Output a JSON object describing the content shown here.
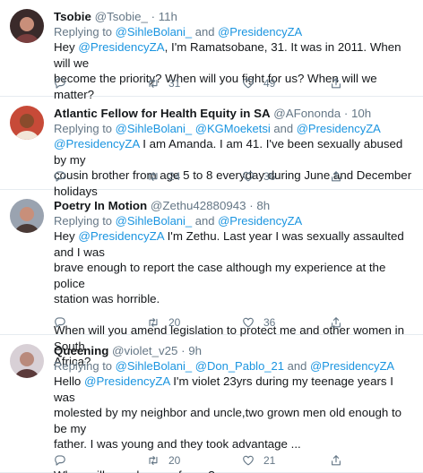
{
  "tweets": [
    {
      "name": "Tsobie",
      "handle": "@Tsobie_",
      "time": "11h",
      "reply_prefix": "Replying to",
      "reply_mentions": [
        "@SihleBolani_",
        "@PresidencyZA"
      ],
      "reply_join": [
        "and"
      ],
      "body_lines": [
        [
          {
            "t": "Hey "
          },
          {
            "m": "@PresidencyZA"
          },
          {
            "t": ", I'm Ramatsobane, 31. It was in 2011. When will we"
          }
        ],
        [
          {
            "t": "become the priority? When will you fight for us? When will we matter?"
          }
        ]
      ],
      "retweets": "31",
      "likes": "49"
    },
    {
      "name": "Atlantic Fellow for Health Equity in SA",
      "handle": "@AFononda",
      "time": "10h",
      "reply_prefix": "Replying to",
      "reply_mentions": [
        "@SihleBolani_",
        "@KGMoeketsi",
        "@PresidencyZA"
      ],
      "reply_join": [
        "",
        "and"
      ],
      "body_lines": [
        [
          {
            "m": "@PresidencyZA"
          },
          {
            "t": " I am Amanda. I am 41. I've been sexually abused by my"
          }
        ],
        [
          {
            "t": "cousin brother from age 5 to 8 everyday during June and December holidays"
          }
        ]
      ],
      "retweets": "24",
      "likes": "36"
    },
    {
      "name": "Poetry In Motion",
      "handle": "@Zethu42880943",
      "time": "8h",
      "reply_prefix": "Replying to",
      "reply_mentions": [
        "@SihleBolani_",
        "@PresidencyZA"
      ],
      "reply_join": [
        "and"
      ],
      "body_lines": [
        [
          {
            "t": "Hey "
          },
          {
            "m": "@PresidencyZA"
          },
          {
            "t": " I'm Zethu. Last year I was sexually assaulted and I was"
          }
        ],
        [
          {
            "t": "brave enough to report the case although my experience at the police"
          }
        ],
        [
          {
            "t": "station was horrible."
          }
        ],
        [],
        [
          {
            "t": "When will you amend legislation to protect me and other women in South"
          }
        ],
        [
          {
            "t": "Africa?"
          }
        ]
      ],
      "retweets": "20",
      "likes": "36"
    },
    {
      "name": "Queening",
      "handle": "@violet_v25",
      "time": "9h",
      "reply_prefix": "Replying to",
      "reply_mentions": [
        "@SihleBolani_",
        "@Don_Pablo_21",
        "@PresidencyZA"
      ],
      "reply_join": [
        "",
        "and"
      ],
      "body_lines": [
        [
          {
            "t": "Hello "
          },
          {
            "m": "@PresidencyZA"
          },
          {
            "t": " I'm violet 23yrs during my teenage years I was"
          }
        ],
        [
          {
            "t": "molested by my neighbor and uncle,two grown men old enough to be my"
          }
        ],
        [
          {
            "t": "father. I was young and they took advantage ..."
          }
        ],
        [],
        [
          {
            "t": "When will you show up for us?"
          }
        ]
      ],
      "retweets": "20",
      "likes": "21"
    }
  ],
  "icons": {
    "reply": "reply-icon",
    "retweet": "retweet-icon",
    "like": "heart-icon",
    "share": "share-icon"
  },
  "colors": {
    "mention": "#1b95e0",
    "secondary": "#657786",
    "text": "#14171a",
    "divider": "#e6ecf0"
  }
}
